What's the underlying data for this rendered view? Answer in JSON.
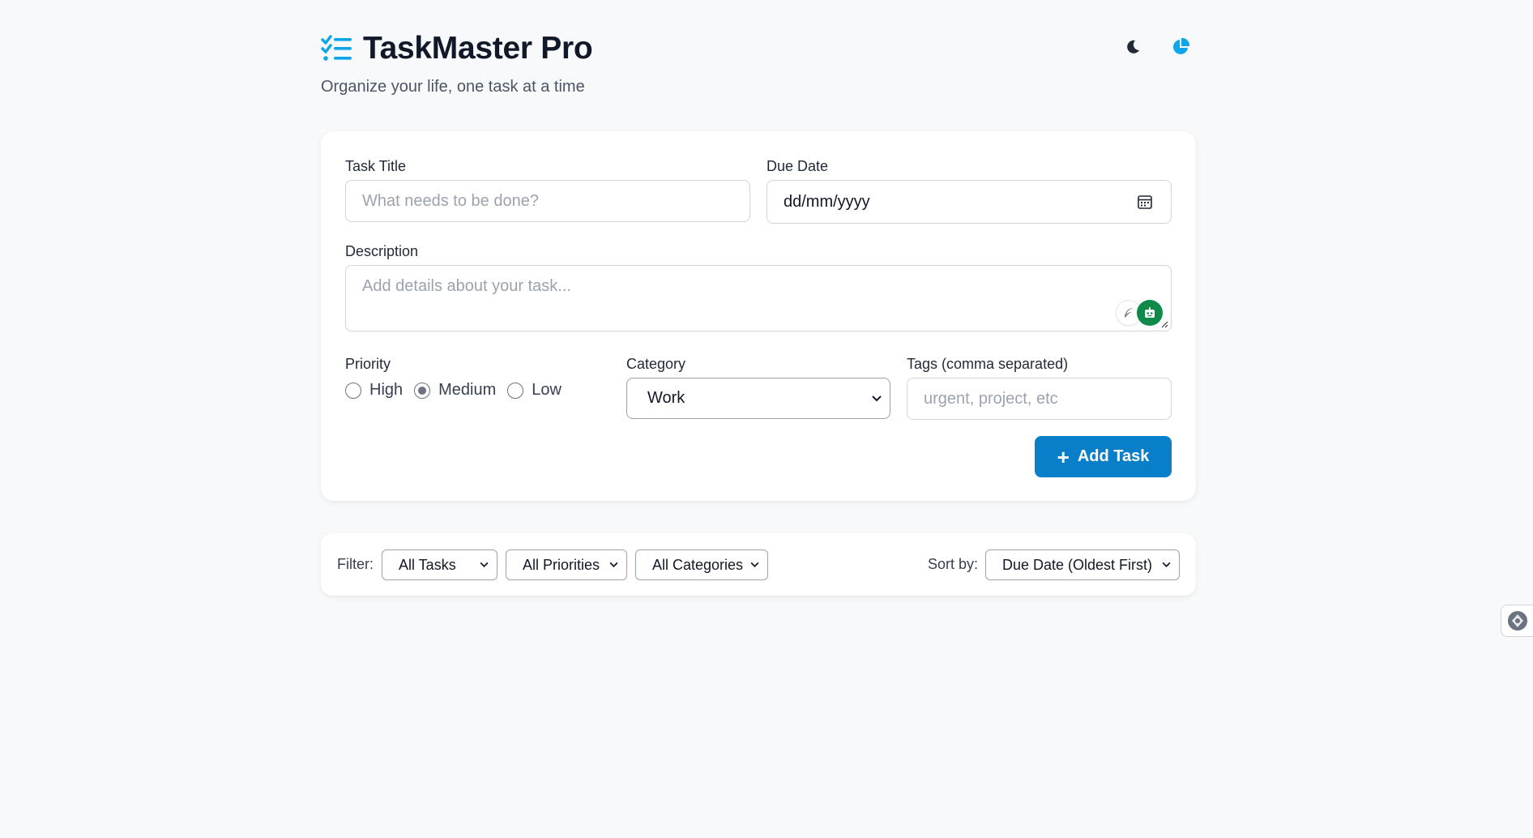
{
  "app": {
    "title": "TaskMaster Pro",
    "subtitle": "Organize your life, one task at a time",
    "accent_color": "#0a7fc9"
  },
  "header_actions": [
    {
      "icon": "moon-icon"
    },
    {
      "icon": "pie-chart-icon"
    }
  ],
  "form": {
    "title_label": "Task Title",
    "title_placeholder": "What needs to be done?",
    "due_label": "Due Date",
    "due_value": "dd/mm/yyyy",
    "description_label": "Description",
    "description_placeholder": "Add details about your task...",
    "priority_label": "Priority",
    "priority_options": [
      "High",
      "Medium",
      "Low"
    ],
    "priority_selected": "Medium",
    "category_label": "Category",
    "category_value": "Work",
    "tags_label": "Tags (comma separated)",
    "tags_placeholder": "urgent, project, etc",
    "add_button": "Add Task"
  },
  "filters": {
    "filter_label": "Filter:",
    "status_value": "All Tasks",
    "priority_value": "All Priorities",
    "category_value": "All Categories",
    "sort_label": "Sort by:",
    "sort_value": "Due Date (Oldest First)"
  }
}
